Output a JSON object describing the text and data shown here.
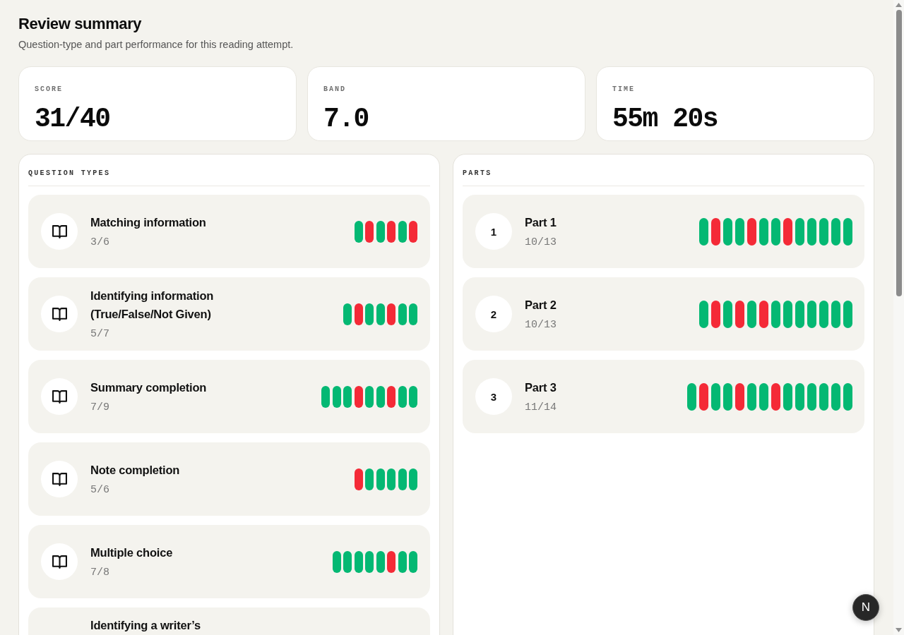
{
  "header": {
    "title": "Review summary",
    "subtitle": "Question-type and part performance for this reading attempt."
  },
  "stats": [
    {
      "label": "SCORE",
      "value": "31/40"
    },
    {
      "label": "BAND",
      "value": "7.0"
    },
    {
      "label": "TIME",
      "value": "55m 20s"
    }
  ],
  "question_types": {
    "heading": "QUESTION TYPES",
    "items": [
      {
        "title": "Matching information",
        "score": "3/6",
        "results": [
          {
            "correct": true
          },
          {
            "correct": false
          },
          {
            "correct": true
          },
          {
            "correct": false
          },
          {
            "correct": true
          },
          {
            "correct": false
          }
        ]
      },
      {
        "title": "Identifying information (True/False/Not Given)",
        "score": "5/7",
        "results": [
          {
            "correct": true
          },
          {
            "correct": false
          },
          {
            "correct": true
          },
          {
            "correct": true
          },
          {
            "correct": false
          },
          {
            "correct": true
          },
          {
            "correct": true
          }
        ]
      },
      {
        "title": "Summary completion",
        "score": "7/9",
        "results": [
          {
            "correct": true
          },
          {
            "correct": true
          },
          {
            "correct": true
          },
          {
            "correct": false
          },
          {
            "correct": true
          },
          {
            "correct": true
          },
          {
            "correct": false
          },
          {
            "correct": true
          },
          {
            "correct": true
          }
        ]
      },
      {
        "title": "Note completion",
        "score": "5/6",
        "results": [
          {
            "correct": false
          },
          {
            "correct": true
          },
          {
            "correct": true
          },
          {
            "correct": true
          },
          {
            "correct": true
          },
          {
            "correct": true
          }
        ]
      },
      {
        "title": "Multiple choice",
        "score": "7/8",
        "results": [
          {
            "correct": true
          },
          {
            "correct": true
          },
          {
            "correct": true
          },
          {
            "correct": true
          },
          {
            "correct": true
          },
          {
            "correct": false
          },
          {
            "correct": true
          },
          {
            "correct": true
          }
        ]
      },
      {
        "title": "Identifying a writer’s"
      }
    ]
  },
  "parts": {
    "heading": "PARTS",
    "items": [
      {
        "number": "1",
        "title": "Part 1",
        "score": "10/13",
        "results": [
          {
            "correct": true
          },
          {
            "correct": false
          },
          {
            "correct": true
          },
          {
            "correct": true
          },
          {
            "correct": false
          },
          {
            "correct": true
          },
          {
            "correct": true
          },
          {
            "correct": false
          },
          {
            "correct": true
          },
          {
            "correct": true
          },
          {
            "correct": true
          },
          {
            "correct": true
          },
          {
            "correct": true
          }
        ]
      },
      {
        "number": "2",
        "title": "Part 2",
        "score": "10/13",
        "results": [
          {
            "correct": true
          },
          {
            "correct": false
          },
          {
            "correct": true
          },
          {
            "correct": false
          },
          {
            "correct": true
          },
          {
            "correct": false
          },
          {
            "correct": true
          },
          {
            "correct": true
          },
          {
            "correct": true
          },
          {
            "correct": true
          },
          {
            "correct": true
          },
          {
            "correct": true
          },
          {
            "correct": true
          }
        ]
      },
      {
        "number": "3",
        "title": "Part 3",
        "score": "11/14",
        "results": [
          {
            "correct": true
          },
          {
            "correct": false
          },
          {
            "correct": true
          },
          {
            "correct": true
          },
          {
            "correct": false
          },
          {
            "correct": true
          },
          {
            "correct": true
          },
          {
            "correct": false
          },
          {
            "correct": true
          },
          {
            "correct": true
          },
          {
            "correct": true
          },
          {
            "correct": true
          },
          {
            "correct": true
          },
          {
            "correct": true
          }
        ]
      }
    ]
  },
  "floating_button": {
    "label": "N"
  }
}
